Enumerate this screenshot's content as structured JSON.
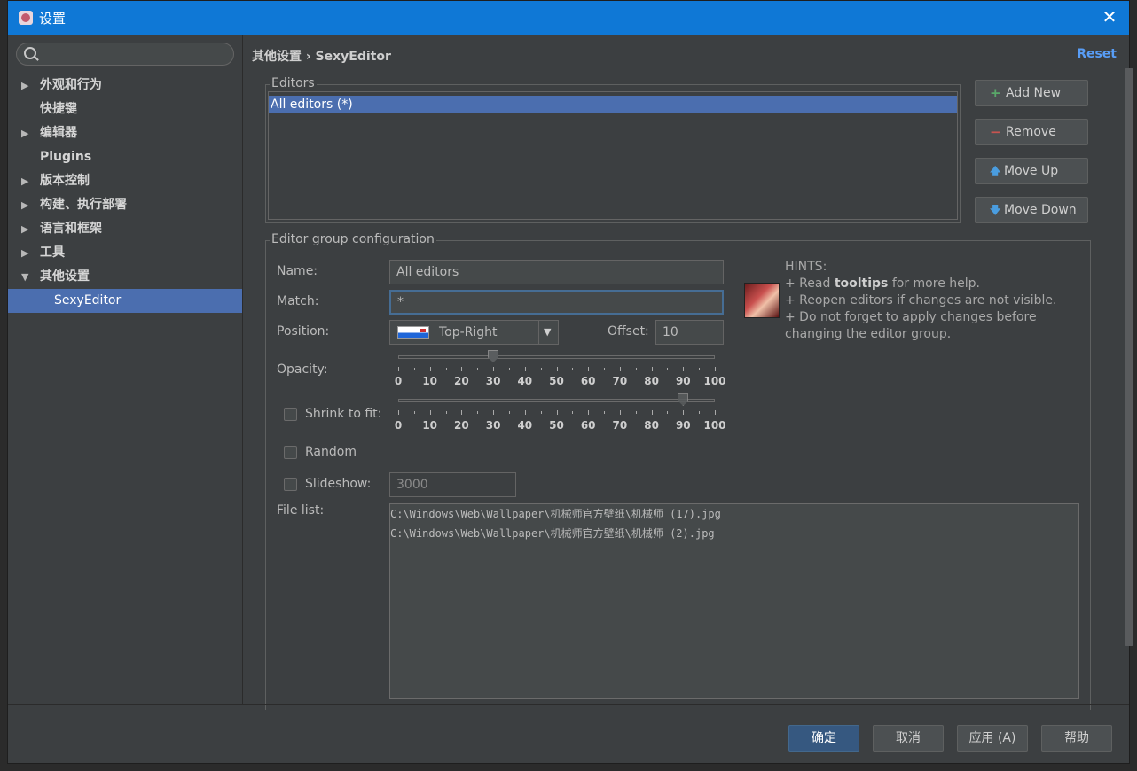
{
  "window": {
    "title": "设置",
    "close_glyph": "✕"
  },
  "sidebar": {
    "search": {
      "placeholder": ""
    },
    "items": [
      {
        "label": "外观和行为",
        "expander": "▶"
      },
      {
        "label": "快捷键",
        "expander": ""
      },
      {
        "label": "编辑器",
        "expander": "▶"
      },
      {
        "label": "Plugins",
        "expander": ""
      },
      {
        "label": "版本控制",
        "expander": "▶"
      },
      {
        "label": "构建、执行部署",
        "expander": "▶"
      },
      {
        "label": "语言和框架",
        "expander": "▶"
      },
      {
        "label": "工具",
        "expander": "▶"
      },
      {
        "label": "其他设置",
        "expander": "▼"
      },
      {
        "label": "SexyEditor",
        "expander": ""
      }
    ]
  },
  "header": {
    "breadcrumb": "其他设置 › SexyEditor",
    "reset_label": "Reset"
  },
  "editors": {
    "legend": "Editors",
    "items": [
      "All editors (*)"
    ],
    "buttons": {
      "add": {
        "icon": "+",
        "label": "Add New"
      },
      "remove": {
        "icon": "−",
        "label": "Remove"
      },
      "up": {
        "icon": "🡅",
        "label": "Move Up"
      },
      "down": {
        "icon": "🡇",
        "label": "Move Down"
      }
    }
  },
  "config": {
    "legend": "Editor group configuration",
    "name_label": "Name:",
    "name_value": "All editors",
    "match_label": "Match:",
    "match_value": "*",
    "position_label": "Position:",
    "position_value": "Top-Right",
    "offset_label": "Offset:",
    "offset_value": "10",
    "opacity_label": "Opacity:",
    "opacity_value": 30,
    "shrink_label": "Shrink to fit:",
    "shrink_value": 90,
    "random_label": "Random",
    "slideshow_label": "Slideshow:",
    "slideshow_value": "3000",
    "filelist_label": "File list:",
    "files": [
      "C:\\Windows\\Web\\Wallpaper\\机械师官方壁纸\\机械师 (17).jpg",
      "C:\\Windows\\Web\\Wallpaper\\机械师官方壁纸\\机械师 (2).jpg"
    ],
    "tick_labels": [
      "0",
      "10",
      "20",
      "30",
      "40",
      "50",
      "60",
      "70",
      "80",
      "90",
      "100"
    ]
  },
  "hints": {
    "title": "HINTS:",
    "line1_pre": "+ Read ",
    "line1_bold": "tooltips",
    "line1_post": " for more help.",
    "line2": "+ Reopen editors if changes are not visible.",
    "line3": "+ Do not forget to apply changes before",
    "line4": "changing the editor group."
  },
  "footer": {
    "ok": "确定",
    "cancel": "取消",
    "apply": "应用 (A)",
    "help": "帮助"
  },
  "colors": {
    "accent": "#0f78d6",
    "selection": "#4b6eaf",
    "link": "#589df6",
    "add_icon": "#59a869",
    "remove_icon": "#c75450",
    "arrow_icon": "#4a9de0"
  }
}
